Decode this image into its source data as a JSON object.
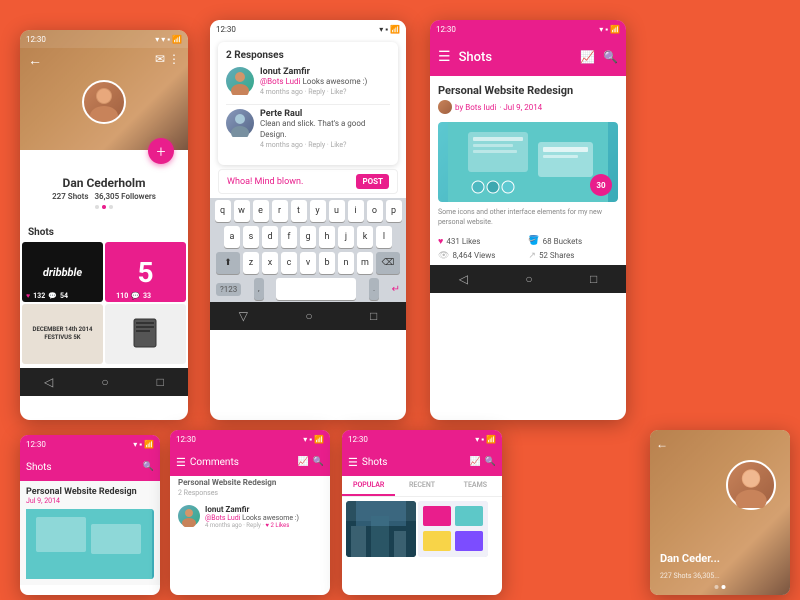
{
  "background_color": "#F05A35",
  "phone1": {
    "status_time": "12:30",
    "user_name": "Dan Cederholm",
    "shots_count": "227 Shots",
    "followers": "36,305 Followers",
    "shots_label": "Shots",
    "shot1_likes": "132",
    "shot1_comments": "54",
    "shot2_likes": "110",
    "shot2_comments": "33",
    "shot3_text": "DECEMBER 14TH, 2014\nFESTIVUS 5K",
    "fab_icon": "+"
  },
  "phone2": {
    "status_time": "12:30",
    "response_count": "2 Responses",
    "comment1_name": "Ionut Zamfir",
    "comment1_tag": "@Bots Ludi",
    "comment1_text": "Looks awesome :)",
    "comment1_meta": "4 months ago · Reply · Like?",
    "comment2_name": "Perte Raul",
    "comment2_text": "Clean and slick. That's a good Design.",
    "comment2_meta": "4 months ago · Reply · Like?",
    "reply_placeholder": "Whoa! Mind blown.",
    "post_label": "POST",
    "keyboard_rows": [
      [
        "q",
        "w",
        "e",
        "r",
        "t",
        "y",
        "u",
        "i",
        "o",
        "p"
      ],
      [
        "a",
        "s",
        "d",
        "f",
        "g",
        "h",
        "j",
        "k",
        "l"
      ],
      [
        "z",
        "x",
        "c",
        "v",
        "b",
        "n",
        "m"
      ]
    ]
  },
  "phone3": {
    "status_time": "12:30",
    "app_title": "Shots",
    "shot_title": "Personal Website Redesign",
    "shot_by": "by Bots ludi",
    "shot_date": "· Jul 9, 2014",
    "shot_desc": "Some icons and other interface elements for my new personal website.",
    "responses": "30",
    "likes": "431 Likes",
    "views": "8,464 Views",
    "buckets": "68 Buckets",
    "shares": "52 Shares"
  },
  "phone4": {
    "status_time": "12:30",
    "app_title": "Shots",
    "shot_title": "Personal Website Redesign",
    "shot_date": "Jul 9, 2014"
  },
  "phone5": {
    "status_time": "12:30",
    "app_title": "Comments",
    "response_count": "2 Responses",
    "preview_title": "Personal Website Redesign",
    "comment1_name": "Ionut Zamfir",
    "comment1_tag": "@Bots Ludi",
    "comment1_text": "Looks awesome :)",
    "comment1_meta": "4 months ago · Reply ·",
    "comment1_likes": "♥ 2 Likes"
  },
  "phone6": {
    "status_time": "12:30",
    "app_title": "Shots",
    "tab_popular": "POPULAR",
    "tab_recent": "RECENT",
    "tab_teams": "TEAMS"
  },
  "phone7": {
    "status_time": "12:30",
    "user_name": "Dan Ceder...",
    "stats": "227 Shots  36,305..."
  }
}
